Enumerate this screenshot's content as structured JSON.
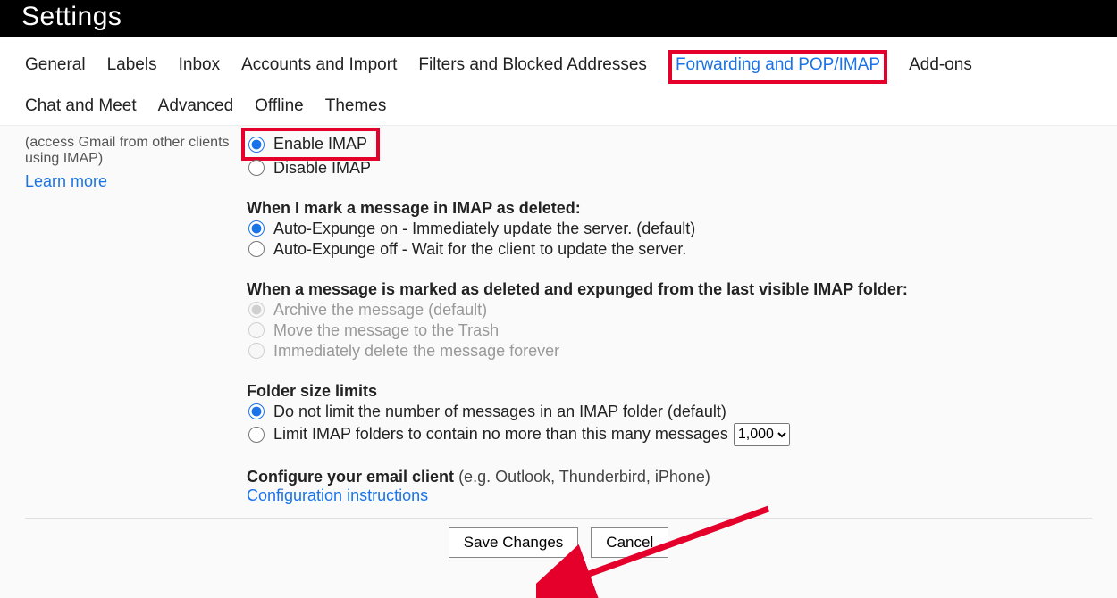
{
  "header": {
    "title": "Settings"
  },
  "tabs": {
    "general": "General",
    "labels": "Labels",
    "inbox": "Inbox",
    "accounts": "Accounts and Import",
    "filters": "Filters and Blocked Addresses",
    "forwarding": "Forwarding and POP/IMAP",
    "addons": "Add-ons",
    "chat": "Chat and Meet",
    "advanced": "Advanced",
    "offline": "Offline",
    "themes": "Themes"
  },
  "side": {
    "hint1": "(access Gmail from other clients",
    "hint2": "using IMAP)",
    "learn": "Learn more"
  },
  "imap": {
    "enable": "Enable IMAP",
    "disable": "Disable IMAP",
    "deleted_title": "When I mark a message in IMAP as deleted:",
    "expunge_on": "Auto-Expunge on - Immediately update the server. (default)",
    "expunge_off": "Auto-Expunge off - Wait for the client to update the server.",
    "expunged_title": "When a message is marked as deleted and expunged from the last visible IMAP folder:",
    "exp_archive": "Archive the message (default)",
    "exp_trash": "Move the message to the Trash",
    "exp_delete": "Immediately delete the message forever",
    "folder_title": "Folder size limits",
    "folder_unlimited": "Do not limit the number of messages in an IMAP folder (default)",
    "folder_limited": "Limit IMAP folders to contain no more than this many messages",
    "folder_limit_value": "1,000",
    "configure_bold": "Configure your email client",
    "configure_paren": "(e.g. Outlook, Thunderbird, iPhone)",
    "configure_link": "Configuration instructions"
  },
  "buttons": {
    "save": "Save Changes",
    "cancel": "Cancel"
  }
}
